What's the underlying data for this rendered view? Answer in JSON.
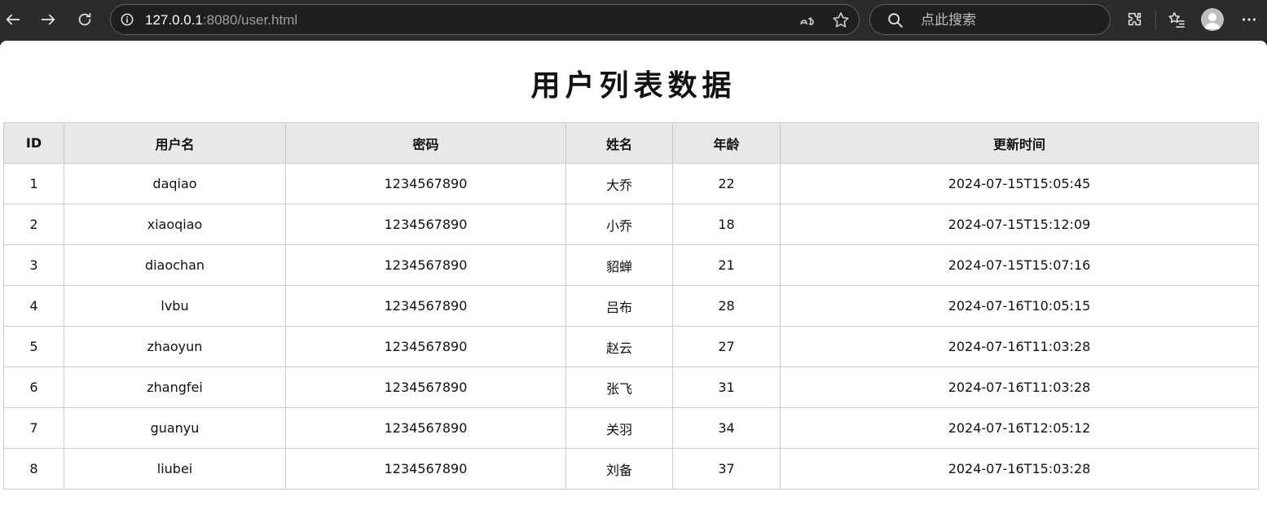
{
  "browser": {
    "url_host": "127.0.0.1",
    "url_rest": ":8080/user.html",
    "search_placeholder": "点此搜索"
  },
  "page": {
    "title": "用户列表数据"
  },
  "table": {
    "headers": [
      "ID",
      "用户名",
      "密码",
      "姓名",
      "年龄",
      "更新时间"
    ],
    "rows": [
      [
        "1",
        "daqiao",
        "1234567890",
        "大乔",
        "22",
        "2024-07-15T15:05:45"
      ],
      [
        "2",
        "xiaoqiao",
        "1234567890",
        "小乔",
        "18",
        "2024-07-15T15:12:09"
      ],
      [
        "3",
        "diaochan",
        "1234567890",
        "貂蝉",
        "21",
        "2024-07-15T15:07:16"
      ],
      [
        "4",
        "lvbu",
        "1234567890",
        "吕布",
        "28",
        "2024-07-16T10:05:15"
      ],
      [
        "5",
        "zhaoyun",
        "1234567890",
        "赵云",
        "27",
        "2024-07-16T11:03:28"
      ],
      [
        "6",
        "zhangfei",
        "1234567890",
        "张飞",
        "31",
        "2024-07-16T11:03:28"
      ],
      [
        "7",
        "guanyu",
        "1234567890",
        "关羽",
        "34",
        "2024-07-16T12:05:12"
      ],
      [
        "8",
        "liubei",
        "1234567890",
        "刘备",
        "37",
        "2024-07-16T15:03:28"
      ]
    ]
  }
}
